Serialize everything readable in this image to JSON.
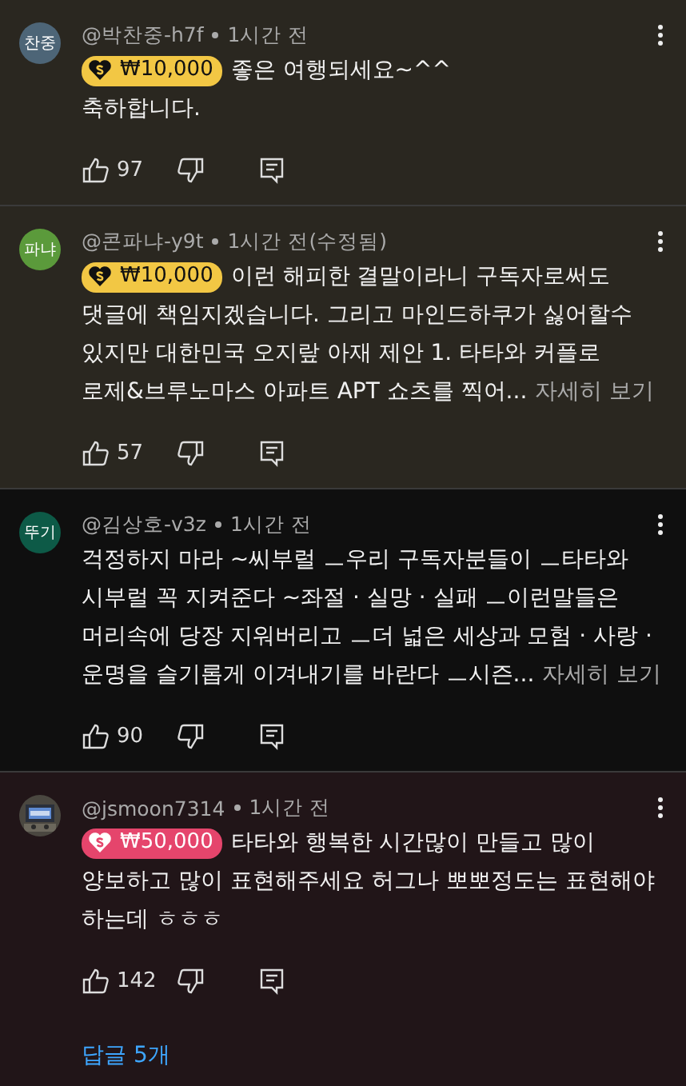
{
  "comments": [
    {
      "avatar": {
        "kind": "initials",
        "text": "찬중",
        "color": "#4d6577"
      },
      "author": "@박찬중-h7f",
      "time": "1시간 전",
      "color": "#2a2720",
      "badge": {
        "amount": "₩10,000",
        "color": "#f2c744"
      },
      "lines": [
        "좋은 여행되세요~^^",
        "축하합니다."
      ],
      "likes": "97"
    },
    {
      "avatar": {
        "kind": "initials",
        "text": "파냐",
        "color": "#5b9a3b"
      },
      "author": "@콘파냐-y9t",
      "time": "1시간 전",
      "edited": "(수정됨)",
      "color": "#2a2720",
      "badge": {
        "amount": "₩10,000",
        "color": "#f2c744"
      },
      "lines": [
        "이런 해피한 결말이라니 구독자로써도",
        "댓글에 책임지겠습니다. 그리고 마인드하쿠가 싫어할수",
        "있지만 대한민국 오지랖 아재 제안 1. 타타와 커플로",
        "로제&브루노마스 아파트 APT 쇼츠를 찍어..."
      ],
      "more": "자세히 보기",
      "likes": "57"
    },
    {
      "avatar": {
        "kind": "initials",
        "text": "뚜기",
        "color": "#0d5a47"
      },
      "author": "@김상호-v3z",
      "time": "1시간 전",
      "color": "#0f0f0f",
      "lines": [
        "걱정하지 마라 ~씨부럴 ㅡ우리 구독자분들이 ㅡ타타와",
        "시부럴 꼭 지켜준다 ~좌절 · 실망  · 실패 ㅡ이런말들은",
        "머리속에 당장 지워버리고 ㅡ더 넓은 세상과 모험 · 사랑  ·",
        "운명을 슬기롭게 이겨내기를 바란다 ㅡ시즌..."
      ],
      "more": "자세히 보기",
      "likes": "90"
    },
    {
      "avatar": {
        "kind": "picture"
      },
      "author": "@jsmoon7314",
      "time": "1시간 전",
      "color": "#211518",
      "badge": {
        "amount": "₩50,000",
        "color": "#e5456c"
      },
      "lines": [
        "타타와 행복한 시간많이 만들고 많이",
        "양보하고 많이 표현해주세요 허그나 뽀뽀정도는 표현해야",
        "하는데 ㅎㅎㅎ"
      ],
      "likes": "142",
      "replies": "답글 5개"
    }
  ]
}
